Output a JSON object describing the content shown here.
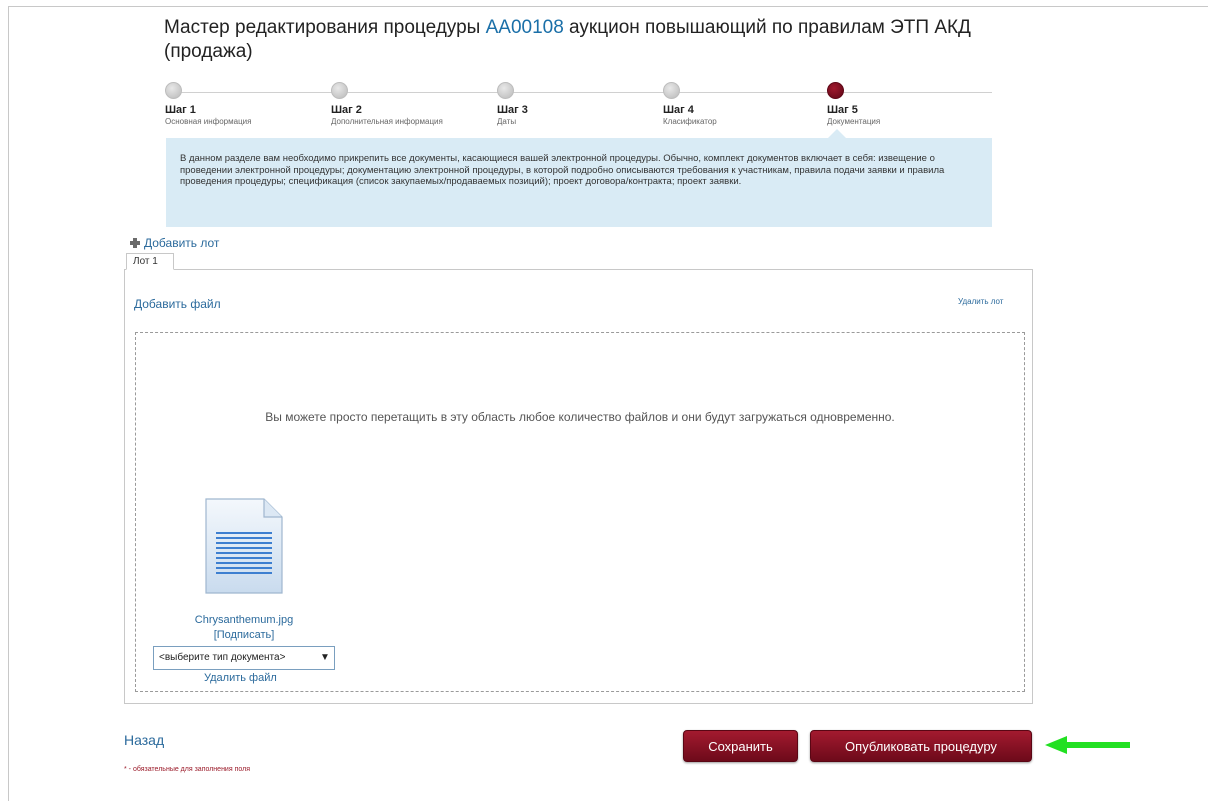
{
  "title": {
    "prefix": "Мастер редактирования процедуры ",
    "code": "АА00108",
    "suffix": " аукцион повышающий по правилам ЭТП АКД (продажа)"
  },
  "steps": [
    {
      "label": "Шаг 1",
      "sub": "Основная информация",
      "active": false
    },
    {
      "label": "Шаг 2",
      "sub": "Дополнительная информация",
      "active": false
    },
    {
      "label": "Шаг 3",
      "sub": "Даты",
      "active": false
    },
    {
      "label": "Шаг 4",
      "sub": "Класификатор",
      "active": false
    },
    {
      "label": "Шаг 5",
      "sub": "Документация",
      "active": true
    }
  ],
  "info_text": "В данном разделе вам необходимо прикрепить все документы, касающиеся вашей электронной процедуры. Обычно, комплект документов включает в себя: извещение о проведении электронной процедуры; документацию электронной процедуры, в которой подробно описываются требования к участникам, правила подачи заявки и правила проведения процедуры; спецификация (список закупаемых/продаваемых позиций); проект договора/контракта; проект заявки.",
  "add_lot": "Добавить лот",
  "lot_tab": "Лот 1",
  "add_file": "Добавить файл",
  "delete_lot": "Удалить лот",
  "drop_text": "Вы можете просто перетащить в эту область любое количество файлов и они будут загружаться одновременно.",
  "file": {
    "name": "Chrysanthemum.jpg",
    "sign": "[Подписать]",
    "doc_type_selected": "<выберите тип документа>",
    "delete": "Удалить файл"
  },
  "back": "Назад",
  "required_note": "* - обязательные для заполнения поля",
  "buttons": {
    "save": "Сохранить",
    "publish": "Опубликовать процедуру"
  },
  "colors": {
    "accent": "#8b1226",
    "link": "#2b6a9c",
    "info_bg": "#d9ebf5",
    "annotation_arrow": "#22e022"
  }
}
